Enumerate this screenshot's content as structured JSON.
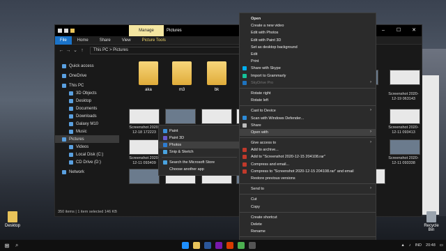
{
  "desktop": {
    "icons": [
      {
        "label": "Desktop"
      },
      {
        "label": "Recycle Bin"
      }
    ]
  },
  "explorer": {
    "title": "Pictures",
    "manage_tab": "Manage",
    "ribbon_tabs": [
      "File",
      "Home",
      "Share",
      "View",
      "Picture Tools"
    ],
    "address": "This PC  >  Pictures",
    "sidebar": [
      {
        "label": "Quick access",
        "level": 0
      },
      {
        "label": "OneDrive",
        "level": 0
      },
      {
        "label": "This PC",
        "level": 0
      },
      {
        "label": "3D Objects",
        "level": 1
      },
      {
        "label": "Desktop",
        "level": 1
      },
      {
        "label": "Documents",
        "level": 1
      },
      {
        "label": "Downloads",
        "level": 1
      },
      {
        "label": "Galaxy M10",
        "level": 1
      },
      {
        "label": "Music",
        "level": 1
      },
      {
        "label": "Pictures",
        "level": 1
      },
      {
        "label": "Videos",
        "level": 1
      },
      {
        "label": "Local Disk (C:)",
        "level": 1
      },
      {
        "label": "CD Drive (D:)",
        "level": 1
      },
      {
        "label": "Network",
        "level": 0
      }
    ],
    "folders": [
      "aka",
      "m3",
      "bk"
    ],
    "thumb_labels": [
      "Screenshot 2020-12-18 172223",
      "Screenshot 2020-12-11 093409",
      "Screenshot 2020-12-19 063143",
      "Screenshot 2020-12-11 093413",
      "Screenshot 2020-12-11 093338"
    ],
    "status": "350 items  |  1 item selected  146 KB"
  },
  "open_with_menu": [
    {
      "label": "Paint",
      "color": "#3b8fd9"
    },
    {
      "label": "Paint 3D",
      "color": "#6a5acd"
    },
    {
      "label": "Photos",
      "color": "#2d7dd2"
    },
    {
      "label": "Snip & Sketch",
      "color": "#4aa3df"
    },
    {
      "label": "Search the Microsoft Store",
      "color": "#4aa3df"
    },
    {
      "label": "Choose another app",
      "color": ""
    }
  ],
  "context_menu": [
    {
      "label": "Open",
      "bold": true
    },
    {
      "label": "Create a new video"
    },
    {
      "label": "Edit with Photos"
    },
    {
      "label": "Edit with Paint 3D"
    },
    {
      "label": "Set as desktop background"
    },
    {
      "label": "Edit"
    },
    {
      "label": "Print"
    },
    {
      "label": "Share with Skype",
      "icon": "#00aff0"
    },
    {
      "label": "Import to Grammarly",
      "icon": "#15c39a"
    },
    {
      "label": "SkyDrive Pro",
      "disabled": true,
      "arrow": true,
      "icon": "#1e73be"
    },
    {
      "sep": true
    },
    {
      "label": "Rotate right"
    },
    {
      "label": "Rotate left"
    },
    {
      "sep": true
    },
    {
      "label": "Cast to Device",
      "arrow": true
    },
    {
      "label": "Scan with Windows Defender...",
      "icon": "#2d8bd8"
    },
    {
      "label": "Share",
      "icon": "#bbbbbb"
    },
    {
      "label": "Open with",
      "arrow": true,
      "highlight": true
    },
    {
      "sep": true
    },
    {
      "label": "Give access to",
      "arrow": true
    },
    {
      "label": "Add to archive...",
      "icon": "#c0392b"
    },
    {
      "label": "Add to \"Screenshot 2020-12-15 204108.rar\"",
      "icon": "#c0392b"
    },
    {
      "label": "Compress and email...",
      "icon": "#c0392b"
    },
    {
      "label": "Compress to \"Screenshot 2020-12-15 204108.rar\" and email",
      "icon": "#c0392b"
    },
    {
      "label": "Restore previous versions"
    },
    {
      "sep": true
    },
    {
      "label": "Send to",
      "arrow": true
    },
    {
      "sep": true
    },
    {
      "label": "Cut"
    },
    {
      "label": "Copy"
    },
    {
      "sep": true
    },
    {
      "label": "Create shortcut"
    },
    {
      "label": "Delete"
    },
    {
      "label": "Rename"
    },
    {
      "sep": true
    },
    {
      "label": "Properties"
    }
  ],
  "taskbar": {
    "time": "20:48",
    "lang": "IND"
  }
}
